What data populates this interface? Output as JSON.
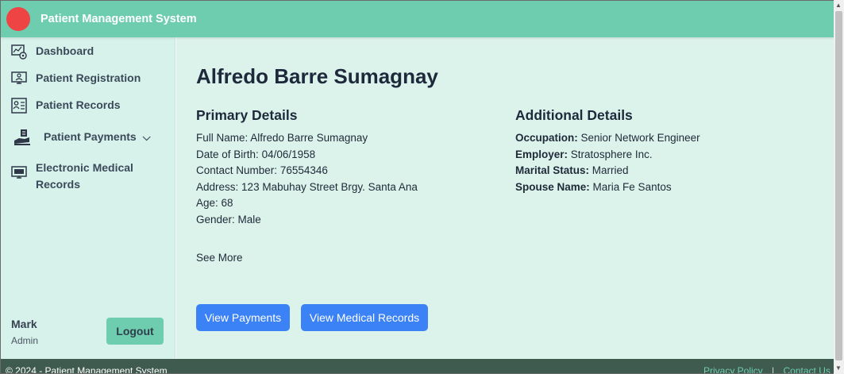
{
  "app": {
    "title": "Patient Management System"
  },
  "sidebar": {
    "items": [
      {
        "label": "Dashboard",
        "icon": "dashboard-icon"
      },
      {
        "label": "Patient Registration",
        "icon": "registration-icon"
      },
      {
        "label": "Patient Records",
        "icon": "records-icon"
      },
      {
        "label": "Patient Payments",
        "icon": "payments-icon"
      },
      {
        "label": "Electronic Medical",
        "label2": "Records",
        "icon": "emr-icon"
      }
    ],
    "user": {
      "name": "Mark",
      "role": "Admin"
    },
    "logout_label": "Logout"
  },
  "patient": {
    "name": "Alfredo Barre Sumagnay",
    "primary": {
      "title": "Primary Details",
      "full_name_label": "Full Name:",
      "full_name": "Alfredo Barre Sumagnay",
      "dob_label": "Date of Birth:",
      "dob": "04/06/1958",
      "contact_label": "Contact Number:",
      "contact": "76554346",
      "address_label": "Address:",
      "address": "123 Mabuhay Street Brgy. Santa Ana",
      "age_label": "Age:",
      "age": "68",
      "gender_label": "Gender:",
      "gender": "Male"
    },
    "additional": {
      "title": "Additional Details",
      "occupation_label": "Occupation:",
      "occupation": "Senior Network Engineer",
      "employer_label": "Employer:",
      "employer": "Stratosphere Inc.",
      "marital_label": "Marital Status:",
      "marital": "Married",
      "spouse_label": "Spouse Name:",
      "spouse": "Maria Fe Santos"
    },
    "see_more": "See More",
    "view_payments": "View Payments",
    "view_medical_records": "View Medical Records"
  },
  "footer": {
    "copyright": "© 2024 - Patient Management System",
    "privacy": "Privacy Policy",
    "separator": "|",
    "contact": "Contact Us"
  },
  "colors": {
    "topbar": "#6ecdae",
    "sidebar": "#d7f2ea",
    "main": "#dcf3ec",
    "button": "#3b82f6",
    "logo": "#ef4444",
    "footer": "#3f5a4f"
  }
}
